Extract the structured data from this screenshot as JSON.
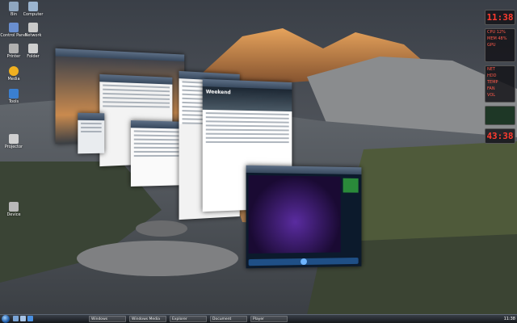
{
  "desktop_icons": [
    {
      "label": "Bin",
      "color": "#8fa6bf"
    },
    {
      "label": "Computer",
      "color": "#9bb4cf"
    },
    {
      "label": "Control Panel",
      "color": "#6a8fd0"
    },
    {
      "label": "Network",
      "color": "#c9c9c9"
    },
    {
      "label": "Printer",
      "color": "#b0b0b0"
    },
    {
      "label": "Folder",
      "color": "#cfcfcf"
    },
    {
      "label": "Media",
      "color": "#f0b020"
    },
    {
      "label": "Tools",
      "color": "#3a7fd0"
    },
    {
      "label": "Projector",
      "color": "#d0d0d0"
    },
    {
      "label": "Device",
      "color": "#b8b8b8"
    }
  ],
  "windows": {
    "photo": {
      "title": ""
    },
    "notepad": {
      "title": ""
    },
    "small": {
      "title": ""
    },
    "editor": {
      "title": ""
    },
    "explorer": {
      "title": ""
    },
    "browser": {
      "title": "",
      "banner": "Weekend"
    },
    "media": {
      "title": ""
    }
  },
  "gadgets": {
    "clock_time": "11:38",
    "counter": "43:38",
    "rows": [
      "CPU 12%",
      "MEM 48%",
      "GPU",
      "NET",
      "HDD",
      "TEMP",
      "FAN",
      "VOL"
    ]
  },
  "taskbar": {
    "tasks": [
      "Windows",
      "Windows Media",
      "Explorer",
      "Document",
      "Player"
    ],
    "time": "11:38"
  },
  "colors": {
    "accent": "#ff3b2f",
    "taskbar": "#1c2026"
  }
}
